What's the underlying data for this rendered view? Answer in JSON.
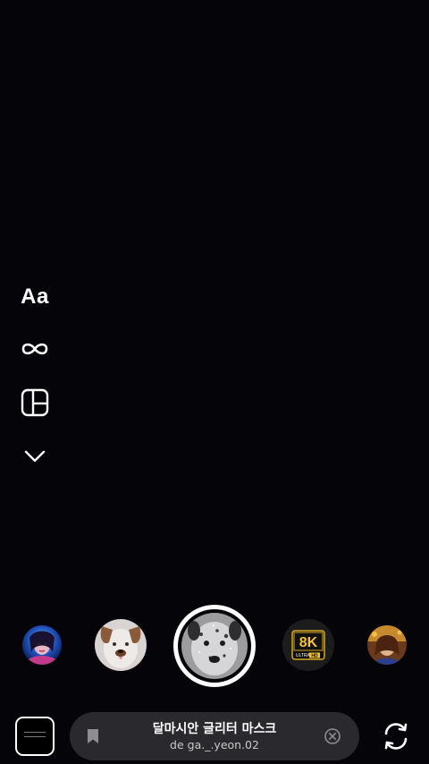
{
  "side_tools": {
    "create_label": "Aa",
    "boomerang_icon": "infinity-icon",
    "layout_icon": "layout-grid-icon",
    "more_icon": "chevron-down-icon"
  },
  "effects": {
    "items": [
      {
        "name": "avatar-effect",
        "icon": "effect-thumbnail"
      },
      {
        "name": "dog-ears-effect",
        "icon": "effect-thumbnail"
      },
      {
        "name": "dalmatian-glitter-mask",
        "icon": "effect-thumbnail",
        "selected": true
      },
      {
        "name": "8k-ultra-hd-effect",
        "icon": "effect-thumbnail",
        "badge_main": "8K",
        "badge_sub": "ULTRA HD"
      },
      {
        "name": "portrait-effect",
        "icon": "effect-thumbnail"
      }
    ]
  },
  "current_effect": {
    "title": "달마시안 글리터 마스크",
    "creator": "de ga._.yeon.02"
  },
  "bottom_bar": {
    "gallery_icon": "gallery-thumbnail",
    "save_icon": "bookmark-icon",
    "close_icon": "close-circle-icon",
    "flip_icon": "flip-camera-icon"
  },
  "colors": {
    "background": "#050409",
    "pill": "#2a2a2e",
    "accent": "#ffffff"
  }
}
